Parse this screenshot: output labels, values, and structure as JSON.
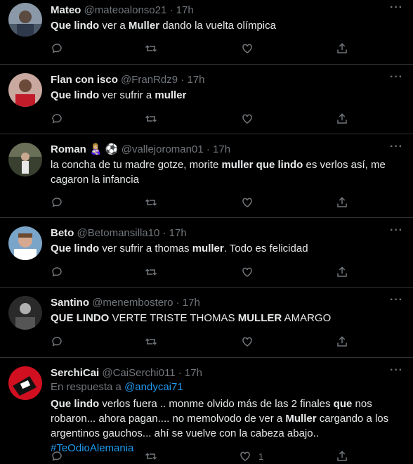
{
  "tweets": [
    {
      "name": "Mateo",
      "handle": "@mateoalonso21",
      "time": "17h",
      "segments": [
        {
          "t": "Que lindo",
          "b": true
        },
        {
          "t": " ver a ",
          "b": false
        },
        {
          "t": "Muller",
          "b": true
        },
        {
          "t": " dando la vuelta olímpica",
          "b": false
        }
      ]
    },
    {
      "name": "Flan con isco",
      "handle": "@FranRdz9",
      "time": "17h",
      "segments": [
        {
          "t": "Que lindo",
          "b": true
        },
        {
          "t": " ver sufrir a ",
          "b": false
        },
        {
          "t": "muller",
          "b": true
        }
      ]
    },
    {
      "name": "Roman",
      "name_emoji": "👩🏼‍🍼 ⚽",
      "handle": "@vallejoroman01",
      "time": "17h",
      "segments": [
        {
          "t": "la concha de tu madre gotze, morite ",
          "b": false
        },
        {
          "t": "muller que lindo",
          "b": true
        },
        {
          "t": " es verlos así, me cagaron la infancia",
          "b": false
        }
      ]
    },
    {
      "name": "Beto",
      "handle": "@Betomansilla10",
      "time": "17h",
      "segments": [
        {
          "t": "Que lindo",
          "b": true
        },
        {
          "t": " ver sufrir a thomas ",
          "b": false
        },
        {
          "t": "muller",
          "b": true
        },
        {
          "t": ". Todo es felicidad",
          "b": false
        }
      ]
    },
    {
      "name": "Santino",
      "handle": "@menembostero",
      "time": "17h",
      "segments": [
        {
          "t": "QUE LINDO",
          "b": true
        },
        {
          "t": " VERTE TRISTE THOMAS ",
          "b": false
        },
        {
          "t": "MULLER",
          "b": true
        },
        {
          "t": " AMARGO",
          "b": false
        }
      ]
    },
    {
      "name": "SerchiCai",
      "handle": "@CaiSerchi011",
      "time": "17h",
      "reply_prefix": "En respuesta a",
      "reply_handle": "@andycai71",
      "segments": [
        {
          "t": "Que lindo",
          "b": true
        },
        {
          "t": " verlos fuera .. monme olvido más de las 2 finales ",
          "b": false
        },
        {
          "t": "que",
          "b": true
        },
        {
          "t": " nos robaron... ahora pagan.... no memolvodo de ver a ",
          "b": false
        },
        {
          "t": "Muller",
          "b": true
        },
        {
          "t": " cargando a los argentinos gauchos... ahí se vuelve con la cabeza abajo.. ",
          "b": false
        },
        {
          "t": "#TeOdioAlemania",
          "b": false,
          "link": true
        }
      ],
      "like_count": "1"
    }
  ],
  "icons": {
    "more": "more-dots-icon",
    "reply": "reply-icon",
    "retweet": "retweet-icon",
    "like": "like-heart-icon",
    "share": "share-icon"
  },
  "colors": {
    "background": "#000000",
    "text": "#e7e9ea",
    "muted": "#71767b",
    "link": "#1d9bf0",
    "divider": "#2f3336"
  }
}
